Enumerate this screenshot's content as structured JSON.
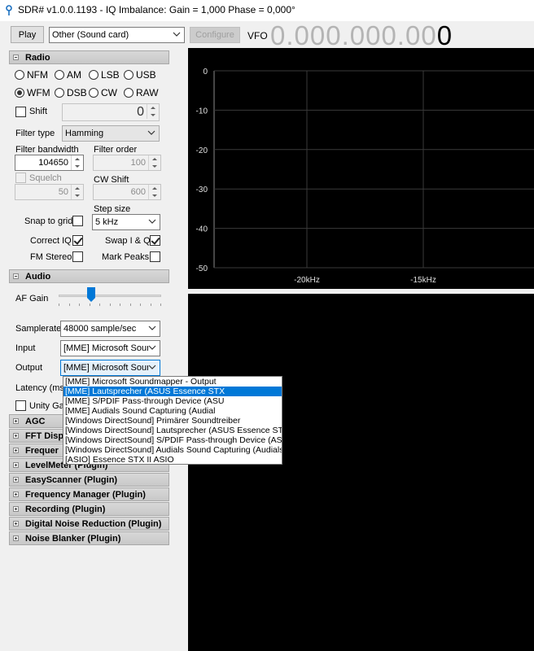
{
  "window": {
    "title": "SDR# v1.0.0.1193 - IQ Imbalance: Gain = 1,000 Phase = 0,000°"
  },
  "toolbar": {
    "play_label": "Play",
    "source_value": "Other (Sound card)",
    "configure_label": "Configure",
    "vfo_label": "VFO",
    "vfo_dim": "0.000.000.00",
    "vfo_last": "0"
  },
  "radio": {
    "header": "Radio",
    "modes": [
      "NFM",
      "AM",
      "LSB",
      "USB",
      "WFM",
      "DSB",
      "CW",
      "RAW"
    ],
    "selected_mode": "WFM",
    "shift_label": "Shift",
    "shift_value": "0",
    "filter_type_label": "Filter type",
    "filter_type_value": "Hamming",
    "filter_bandwidth_label": "Filter bandwidth",
    "filter_bandwidth_value": "104650",
    "filter_order_label": "Filter order",
    "filter_order_value": "100",
    "squelch_label": "Squelch",
    "squelch_value": "50",
    "cw_shift_label": "CW Shift",
    "cw_shift_value": "600",
    "step_size_label": "Step size",
    "step_size_value": "5 kHz",
    "snap_label": "Snap to grid",
    "correct_iq_label": "Correct IQ",
    "swap_iq_label": "Swap I & Q",
    "fm_stereo_label": "FM Stereo",
    "mark_peaks_label": "Mark Peaks"
  },
  "audio": {
    "header": "Audio",
    "af_gain_label": "AF Gain",
    "af_gain_level": 0.3,
    "samplerate_label": "Samplerate",
    "samplerate_value": "48000 sample/sec",
    "input_label": "Input",
    "input_value": "[MME] Microsoft Sound",
    "output_label": "Output",
    "output_value": "[MME] Microsoft Sound",
    "latency_label": "Latency (ms",
    "unity_gain_label": "Unity Ga"
  },
  "output_options": [
    "[MME] Microsoft Soundmapper - Output",
    "[MME] Lautsprecher (ASUS Essence STX",
    "[MME] S/PDIF Pass-through Device (ASU",
    "[MME] Audials Sound Capturing (Audial",
    "[Windows DirectSound] Primärer Soundtreiber",
    "[Windows DirectSound] Lautsprecher (ASUS Essence STX II A",
    "[Windows DirectSound] S/PDIF Pass-through Device (ASUS E",
    "[Windows DirectSound] Audials Sound Capturing (Audials Sou",
    "[ASIO] Essence STX II ASIO"
  ],
  "output_selected_index": 1,
  "plugins": {
    "agc": "AGC",
    "fft": "FFT Disp",
    "freq": "Frequer",
    "level": "LevelMeter (Plugin)",
    "easy": "EasyScanner (Plugin)",
    "fmgr": "Frequency Manager (Plugin)",
    "rec": "Recording (Plugin)",
    "dnr": "Digital Noise Reduction (Plugin)",
    "nb": "Noise Blanker (Plugin)"
  },
  "spectrum": {
    "y_ticks": [
      "0",
      "-10",
      "-20",
      "-30",
      "-40",
      "-50"
    ],
    "x_ticks": [
      "-20kHz",
      "-15kHz"
    ]
  },
  "colors": {
    "selection": "#0078d7",
    "display_bg": "#000000",
    "grid": "#3a3a3a"
  }
}
